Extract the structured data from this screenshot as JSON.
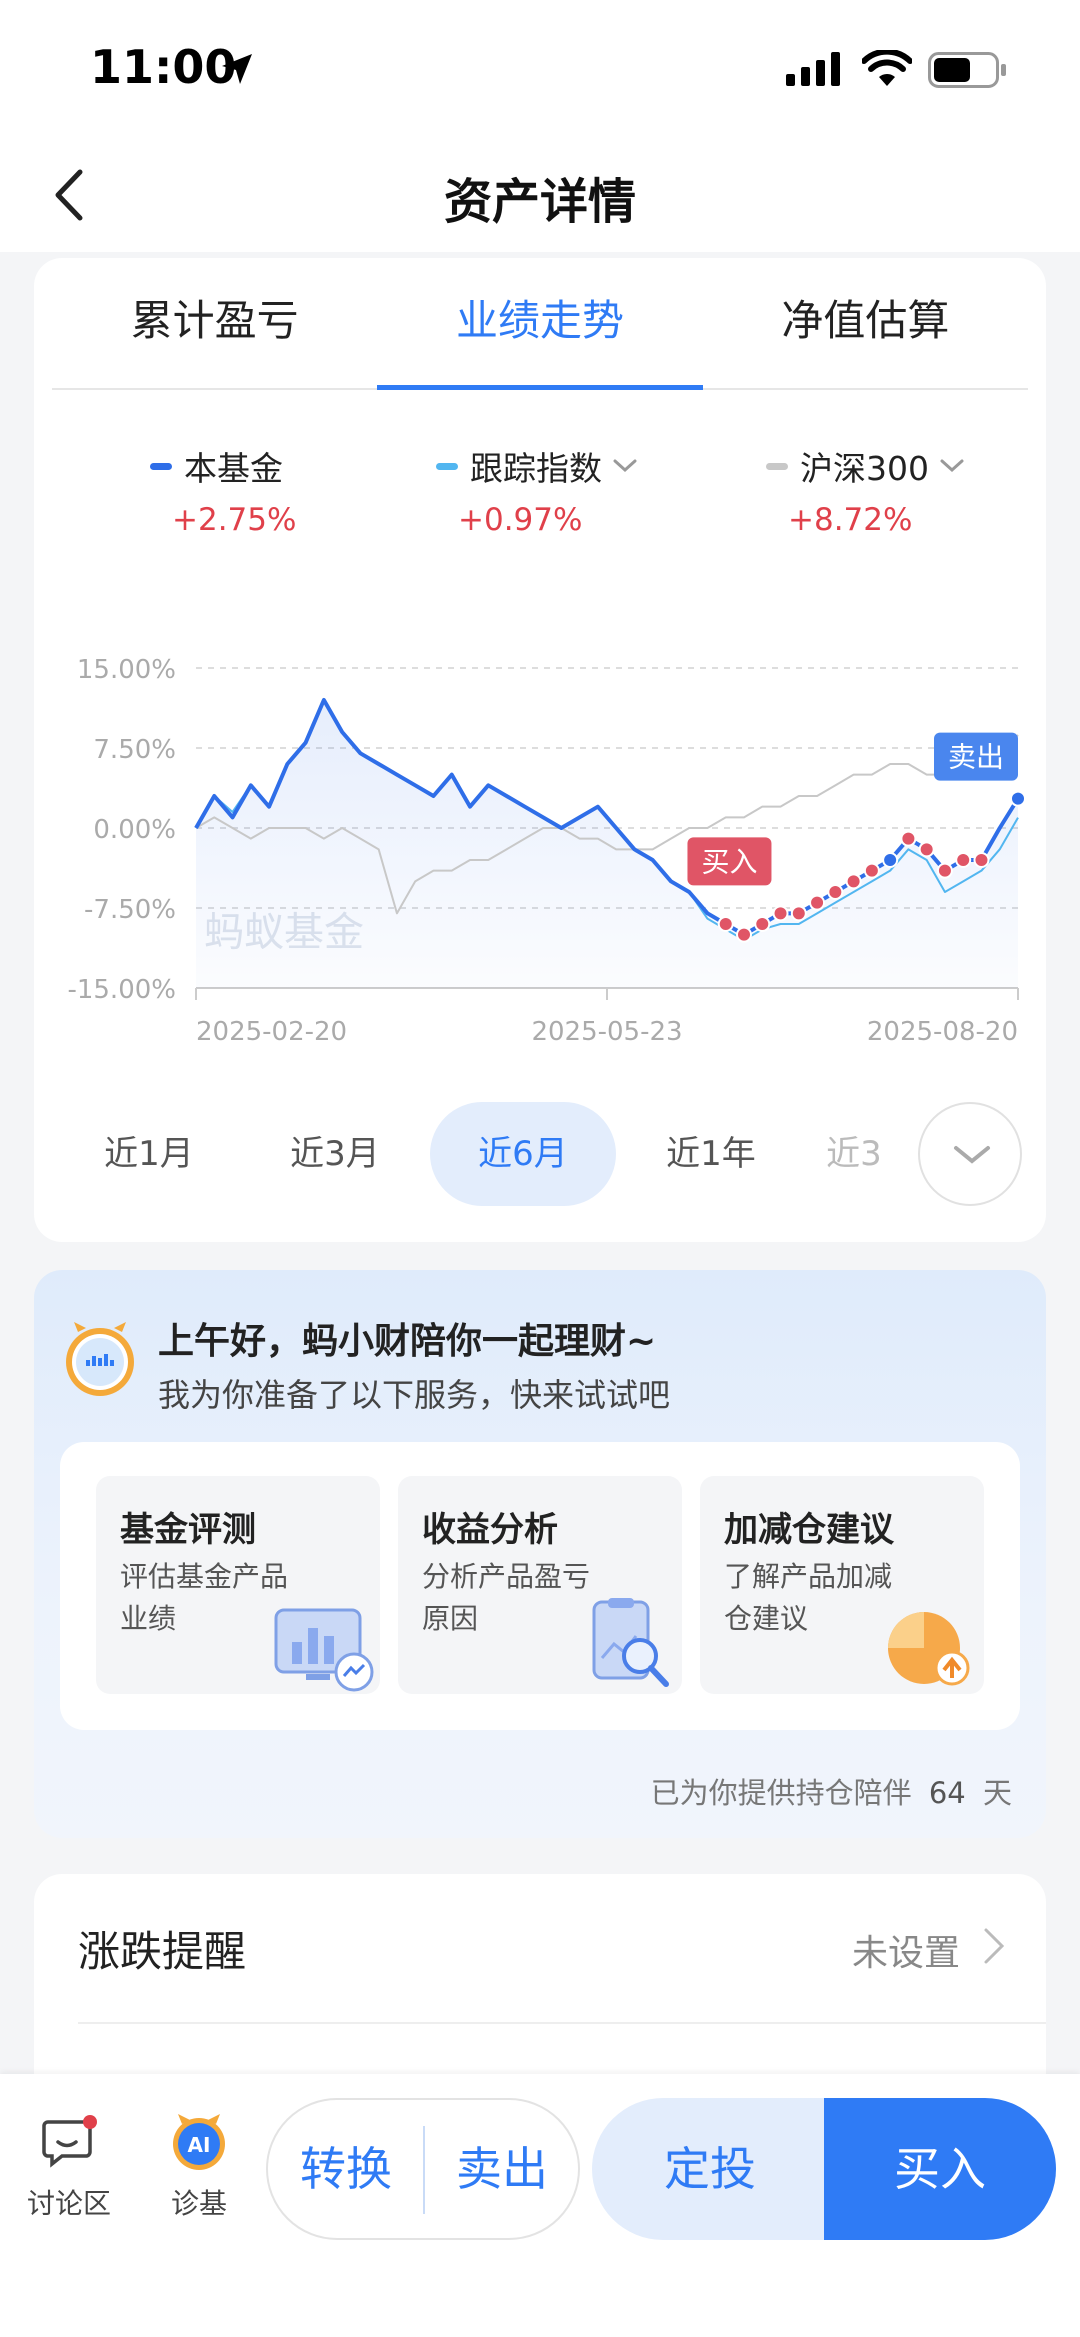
{
  "status_bar": {
    "time": "11:00"
  },
  "nav": {
    "title": "资产详情"
  },
  "tabs": [
    {
      "label": "累计盈亏"
    },
    {
      "label": "业绩走势"
    },
    {
      "label": "净值估算"
    }
  ],
  "active_tab": "业绩走势",
  "legend": [
    {
      "name": "本基金",
      "value": "+2.75%",
      "color": "#2f6ee8"
    },
    {
      "name": "跟踪指数",
      "value": "+0.97%",
      "color": "#52b6f0"
    },
    {
      "name": "沪深300",
      "value": "+8.72%",
      "color": "#c8c8c8"
    }
  ],
  "chart": {
    "watermark": "蚂蚁基金",
    "buy_tag": "买入",
    "sell_tag": "卖出"
  },
  "chart_data": {
    "type": "line",
    "y_ticks": [
      "15.00%",
      "7.50%",
      "0.00%",
      "-7.50%",
      "-15.00%"
    ],
    "ylim": [
      -15,
      15
    ],
    "x_ticks": [
      "2025-02-20",
      "2025-05-23",
      "2025-08-20"
    ],
    "x": [
      0,
      4,
      8,
      12,
      16,
      20,
      24,
      28,
      32,
      36,
      40,
      44,
      48,
      52,
      56,
      60,
      64,
      68,
      72,
      76,
      80,
      84,
      88,
      92,
      96,
      100,
      104,
      108,
      112,
      116,
      120,
      124,
      128,
      132,
      136,
      140,
      144,
      148,
      152,
      156,
      160,
      164,
      168,
      172,
      176,
      180
    ],
    "series": [
      {
        "name": "本基金",
        "color": "#2f6ee8",
        "values": [
          0,
          3,
          1,
          4,
          2,
          6,
          8,
          12,
          9,
          7,
          6,
          5,
          4,
          3,
          5,
          2,
          4,
          3,
          2,
          1,
          0,
          1,
          2,
          0,
          -2,
          -3,
          -5,
          -6,
          -8,
          -9,
          -10,
          -9,
          -8,
          -8,
          -7,
          -6,
          -5,
          -4,
          -3,
          -1,
          -2,
          -4,
          -3,
          -3,
          0,
          2.75
        ]
      },
      {
        "name": "跟踪指数",
        "color": "#52b6f0",
        "values": [
          0,
          3,
          1.5,
          4,
          2,
          6,
          8,
          12,
          9,
          7,
          6,
          5,
          4,
          3,
          5,
          2,
          4,
          3,
          2,
          1,
          0,
          1,
          2,
          0,
          -2,
          -3,
          -5,
          -6,
          -8.5,
          -9.5,
          -10.5,
          -9.5,
          -9,
          -9,
          -8,
          -7,
          -6,
          -5,
          -4,
          -2,
          -3,
          -6,
          -5,
          -4,
          -2,
          0.97
        ]
      },
      {
        "name": "沪深300",
        "color": "#c8c8c8",
        "values": [
          0,
          1,
          0,
          -1,
          0,
          0,
          0,
          -1,
          0,
          -1,
          -2,
          -8,
          -5,
          -4,
          -4,
          -3,
          -3,
          -2,
          -1,
          0,
          0,
          -1,
          -1,
          -2,
          -2,
          -2,
          -1,
          0,
          0,
          1,
          1,
          2,
          2,
          3,
          3,
          4,
          5,
          5,
          6,
          6,
          5,
          5,
          6,
          6,
          7,
          8.72
        ]
      }
    ]
  },
  "ranges": [
    {
      "label": "近1月"
    },
    {
      "label": "近3月"
    },
    {
      "label": "近6月"
    },
    {
      "label": "近1年"
    },
    {
      "label": "近3"
    }
  ],
  "active_range": "近6月",
  "assistant": {
    "greeting": "上午好，蚂小财陪你一起理财~",
    "sub": "我为你准备了以下服务，快来试试吧",
    "services": [
      {
        "title": "基金评测",
        "desc": "评估基金产品业绩",
        "icon": "chart-screen-icon"
      },
      {
        "title": "收益分析",
        "desc": "分析产品盈亏原因",
        "icon": "magnifier-report-icon"
      },
      {
        "title": "加减仓建议",
        "desc": "了解产品加减仓建议",
        "icon": "pie-chart-icon"
      }
    ],
    "company_prefix": "已为你提供持仓陪伴",
    "company_days": "64",
    "company_suffix": "天"
  },
  "alert": {
    "title": "涨跌提醒",
    "status": "未设置"
  },
  "bottom": {
    "forum": "讨论区",
    "diagnose": "诊基",
    "convert": "转换",
    "sell": "卖出",
    "sip": "定投",
    "buy": "买入",
    "accent": "#2f7bf5"
  }
}
